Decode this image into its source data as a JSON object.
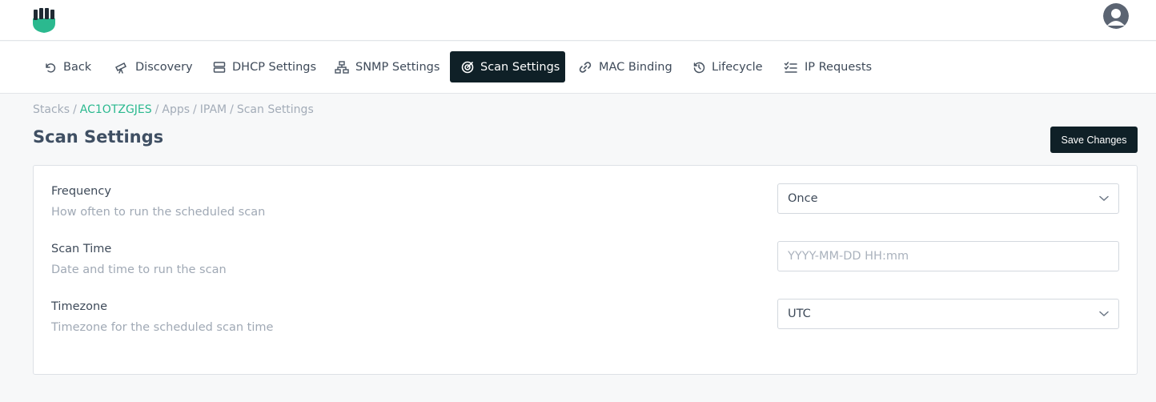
{
  "header": {
    "logo": "app-logo",
    "avatar": "user-avatar"
  },
  "nav": {
    "items": [
      {
        "label": "Back",
        "icon": "undo-icon"
      },
      {
        "label": "Discovery",
        "icon": "telescope-icon"
      },
      {
        "label": "DHCP Settings",
        "icon": "server-icon"
      },
      {
        "label": "SNMP Settings",
        "icon": "network-icon"
      },
      {
        "label": "Scan Settings",
        "icon": "target-icon",
        "active": true
      },
      {
        "label": "MAC Binding",
        "icon": "link-icon"
      },
      {
        "label": "Lifecycle",
        "icon": "history-icon"
      },
      {
        "label": "IP Requests",
        "icon": "checklist-icon"
      }
    ]
  },
  "breadcrumb": [
    "Stacks",
    "AC1OTZGJES",
    "Apps",
    "IPAM",
    "Scan Settings"
  ],
  "page": {
    "title": "Scan Settings",
    "save_label": "Save Changes"
  },
  "form": {
    "frequency": {
      "label": "Frequency",
      "help": "How often to run the scheduled scan",
      "value": "Once"
    },
    "scan_time": {
      "label": "Scan Time",
      "help": "Date and time to run the scan",
      "placeholder": "YYYY-MM-DD HH:mm",
      "value": ""
    },
    "timezone": {
      "label": "Timezone",
      "help": "Timezone for the scheduled scan time",
      "value": "UTC"
    }
  },
  "colors": {
    "accent": "#2bb98f",
    "dark": "#0f2027"
  }
}
